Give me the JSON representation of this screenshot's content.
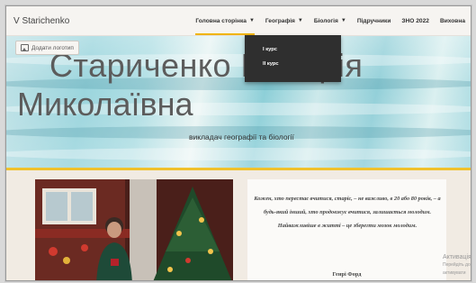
{
  "site": {
    "name": "V Starichenko"
  },
  "nav": {
    "items": [
      {
        "label": "Головна сторінка",
        "has_dropdown": true,
        "active": true
      },
      {
        "label": "Географія",
        "has_dropdown": true,
        "active": false
      },
      {
        "label": "Біологія",
        "has_dropdown": true,
        "active": false
      },
      {
        "label": "Підручники",
        "has_dropdown": false,
        "active": false
      },
      {
        "label": "ЗНО 2022",
        "has_dropdown": false,
        "active": false
      },
      {
        "label": "Виховна",
        "has_dropdown": false,
        "active": false
      }
    ],
    "chevron": "chevron-down-icon",
    "accent_color": "#f0b400"
  },
  "dropdown": {
    "open_under": "Географія",
    "items": [
      "І курс",
      "ІІ курс"
    ],
    "background": "#2f2f2f"
  },
  "hero": {
    "add_logo_label": "Додати логотип",
    "name_line1": "Стариченко Вікторія",
    "name_line2": "Миколаївна",
    "subtitle": "викладач географії та біології",
    "border_color": "#f0c12c"
  },
  "quote": {
    "text": "Кожен, хто перестає вчитися, старіє, – не важливо, в 20 або 80 років, – а будь-який інший, хто продовжує вчитися, залишається молодим. Найважливіше в житті – це зберегти мозок молодим.",
    "author": "Генрі Форд"
  },
  "watermark": {
    "line1": "Активація",
    "line2": "Перейдіть до",
    "line3": "активувати"
  }
}
